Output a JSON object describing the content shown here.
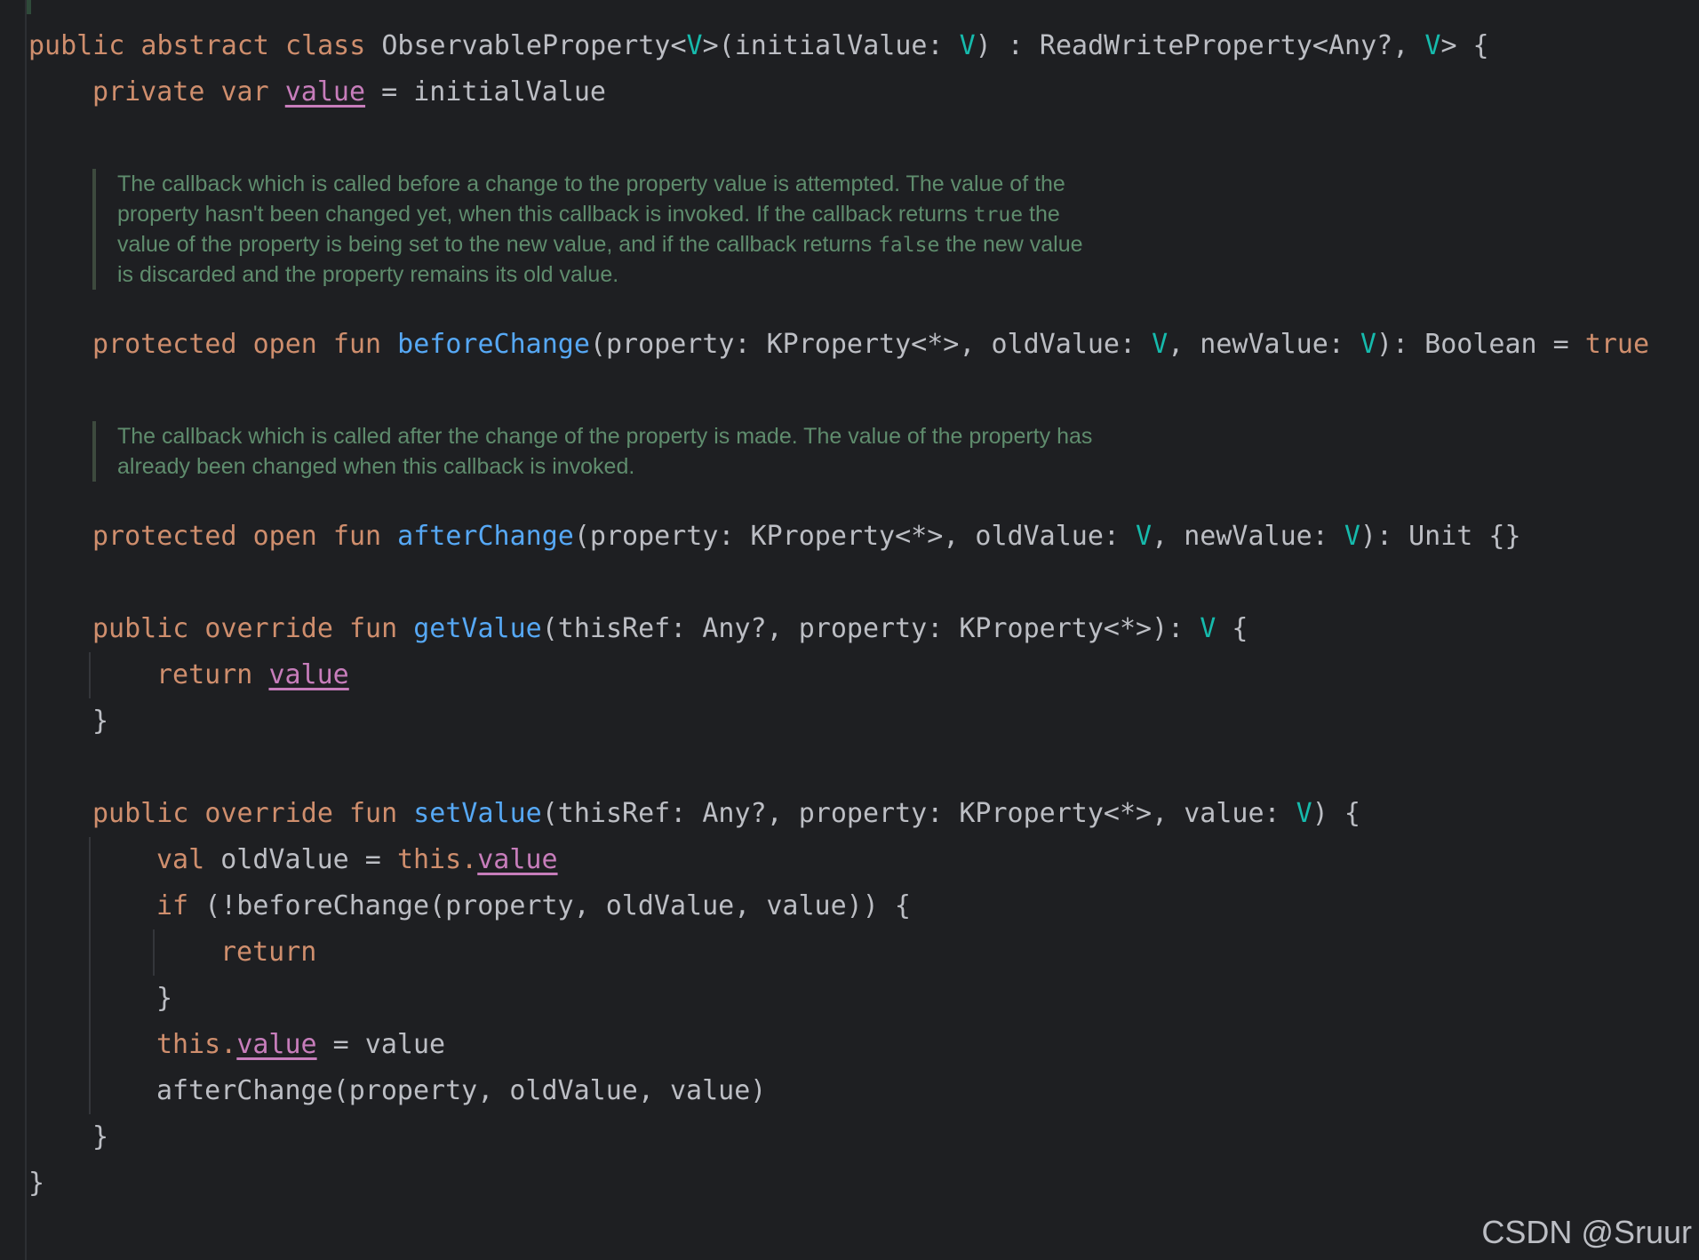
{
  "code": {
    "class_decl": {
      "kw": "public abstract class ",
      "name": "ObservableProperty<",
      "tp1": "V",
      "mid": ">(initialValue: ",
      "tp2": "V",
      "mid2": ") : ReadWriteProperty<Any?, ",
      "tp3": "V",
      "end": "> {"
    },
    "private_var": {
      "kw": "private var ",
      "prop": "value",
      "rest": " = initialValue"
    },
    "doc1": {
      "line1": "The callback which is called before a change to the property value is attempted. The value of the",
      "line2_a": "property hasn't been changed yet, when this callback is invoked. If the callback returns ",
      "line2_code": "true",
      "line2_b": " the",
      "line3_a": "value of the property is being set to the new value, and if the callback returns ",
      "line3_code": "false",
      "line3_b": " the new value",
      "line4": "is discarded and the property remains its old value."
    },
    "before_change": {
      "kw": "protected open fun ",
      "fn": "beforeChange",
      "p1": "(property: KProperty<*>, oldValue: ",
      "tp1": "V",
      "p2": ", newValue: ",
      "tp2": "V",
      "p3": "): Boolean = ",
      "kw_true": "true"
    },
    "doc2": {
      "line1": "The callback which is called after the change of the property is made. The value of the property has",
      "line2": "already been changed when this callback is invoked."
    },
    "after_change": {
      "kw": "protected open fun ",
      "fn": "afterChange",
      "p1": "(property: KProperty<*>, oldValue: ",
      "tp1": "V",
      "p2": ", newValue: ",
      "tp2": "V",
      "p3": "): Unit {}"
    },
    "get_value": {
      "kw": "public override fun ",
      "fn": "getValue",
      "p1": "(thisRef: Any?, property: KProperty<*>): ",
      "tp": "V",
      "p2": " {"
    },
    "return_value": {
      "kw": "return ",
      "prop": "value"
    },
    "close_brace": "}",
    "set_value": {
      "kw": "public override fun ",
      "fn": "setValue",
      "p1": "(thisRef: Any?, property: KProperty<*>, value: ",
      "tp": "V",
      "p2": ") {"
    },
    "val_old": {
      "kw": "val ",
      "p1": "oldValue = ",
      "kw_this": "this.",
      "prop": "value"
    },
    "if_line": {
      "kw": "if ",
      "rest": "(!beforeChange(property, oldValue, value)) {"
    },
    "return_kw": "return",
    "this_assign": {
      "kw_this": "this.",
      "prop": "value",
      "rest": " = value"
    },
    "after_call": "afterChange(property, oldValue, value)"
  },
  "watermark": "CSDN @Sruur"
}
